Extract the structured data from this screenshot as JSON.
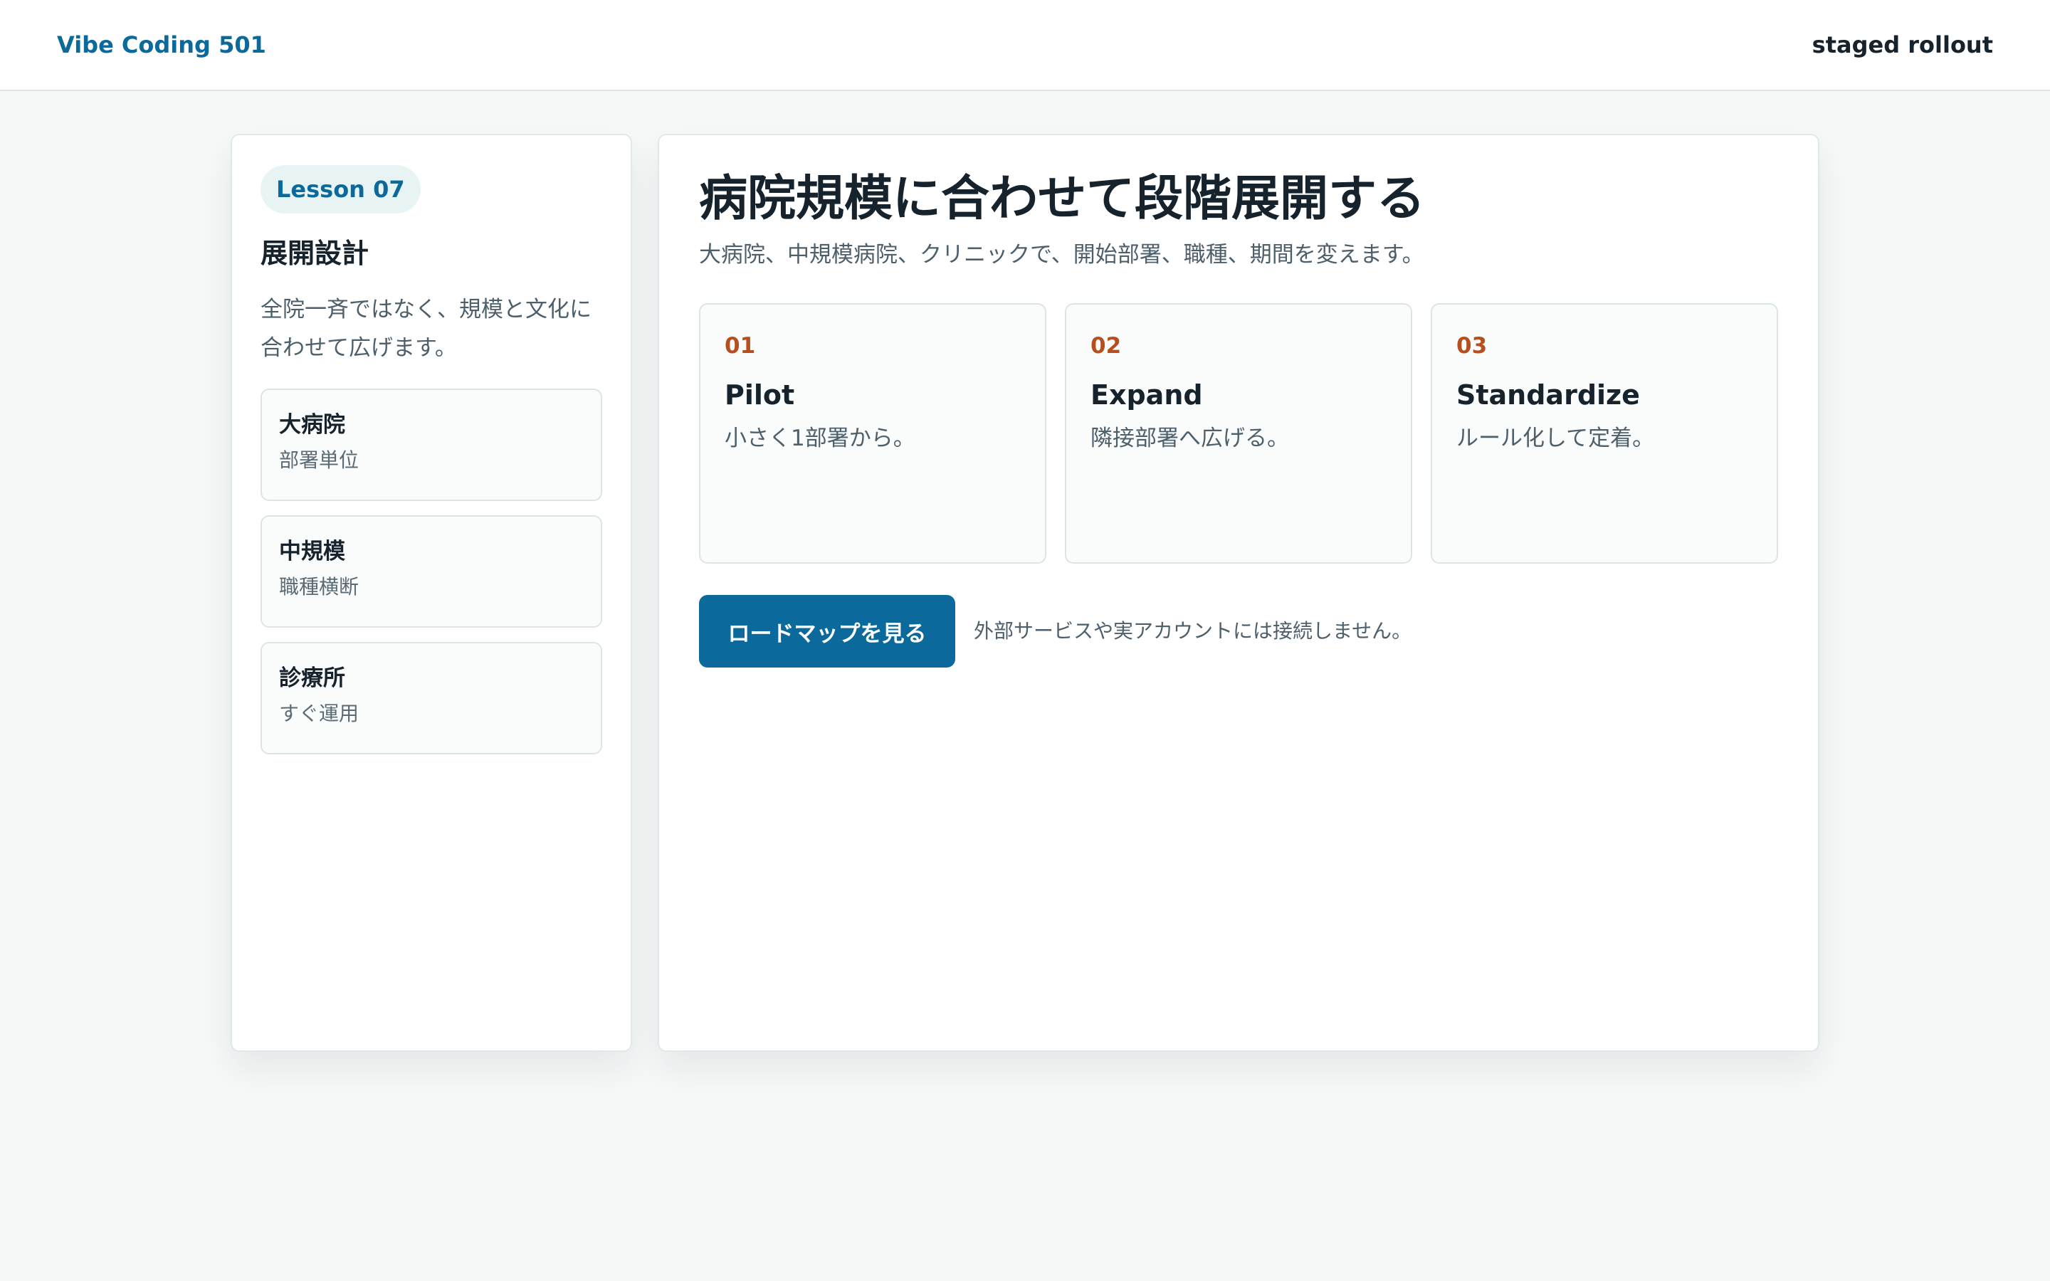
{
  "header": {
    "brand": "Vibe Coding 501",
    "right_label": "staged rollout"
  },
  "sidebar": {
    "lesson_badge": "Lesson 07",
    "title": "展開設計",
    "description_line1": "全院一斉ではなく、規模と文化に",
    "description_line2": "合わせて広げます。",
    "items": [
      {
        "name": "大病院",
        "note": "部署単位"
      },
      {
        "name": "中規模",
        "note": "職種横断"
      },
      {
        "name": "診療所",
        "note": "すぐ運用"
      }
    ]
  },
  "main": {
    "title": "病院規模に合わせて段階展開する",
    "subtitle": "大病院、中規模病院、クリニックで、開始部署、職種、期間を変えます。",
    "steps": [
      {
        "number": "01",
        "title": "Pilot",
        "text": "小さく1部署から。"
      },
      {
        "number": "02",
        "title": "Expand",
        "text": "隣接部署へ広げる。"
      },
      {
        "number": "03",
        "title": "Standardize",
        "text": "ルール化して定着。"
      }
    ],
    "cta_label": "ロードマップを見る",
    "note": "外部サービスや実アカウントには接続しません。"
  },
  "colors": {
    "accent": "#0b6a9b",
    "step_number": "#b4501f",
    "page_background": "#f4f8f7"
  }
}
